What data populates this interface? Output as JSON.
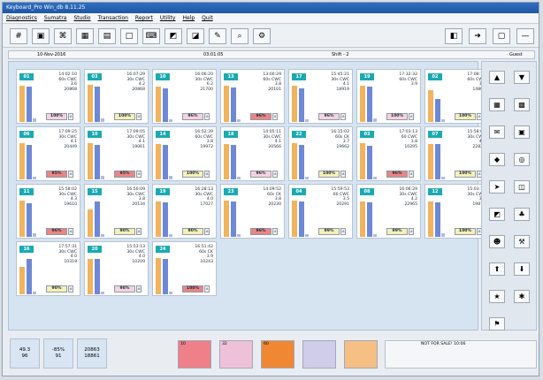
{
  "window_title": "Keyboard_Pro Win_db 8.11.25",
  "menus": [
    "Diagnostics",
    "Sumatra",
    "Studio",
    "Transaction",
    "Report",
    "Utility",
    "Help",
    "Quit"
  ],
  "status": {
    "date": "10-Nov-2016",
    "time": "03:01:05",
    "shift": "Shift - 2",
    "user": "Guest"
  },
  "cards": [
    {
      "id": "01",
      "time": "14:02:10",
      "type": "60s CWC",
      "val": "3.6",
      "count": "20868",
      "pct": "100%",
      "pct_color": "#f6d2e0",
      "bars": [
        0.94,
        0.9,
        0.1
      ]
    },
    {
      "id": "03",
      "time": "16:07:29",
      "type": "30s CWC",
      "val": "4.2",
      "count": "20868",
      "pct": "100%",
      "pct_color": "#f4f0b8",
      "bars": [
        0.95,
        0.9,
        0.08
      ]
    },
    {
      "id": "10",
      "time": "16:06:20",
      "type": "30s CWC",
      "val": "6.2",
      "count": "21700",
      "pct": "96%",
      "pct_color": "#f6d2e0",
      "bars": [
        0.92,
        0.86,
        0.07
      ]
    },
    {
      "id": "13",
      "time": "13:00:29",
      "type": "60s CWC",
      "val": "3.8",
      "count": "20101",
      "pct": "96%",
      "pct_color": "#e98585",
      "bars": [
        0.93,
        0.89,
        0.07
      ]
    },
    {
      "id": "17",
      "time": "15:45:21",
      "type": "30s CWC",
      "val": "4.1",
      "count": "18919",
      "pct": "96%",
      "pct_color": "#f6d2e0",
      "bars": [
        0.93,
        0.87,
        0.06
      ]
    },
    {
      "id": "19",
      "time": "17:32:32",
      "type": "60s CWC",
      "val": "3.9",
      "count": "",
      "pct": "100%",
      "pct_color": "#f6d2e0",
      "bars": [
        0.94,
        0.91,
        0.08
      ]
    },
    {
      "id": "02",
      "time": "17:08:12",
      "type": "60s CWC",
      "val": "3.7",
      "count": "14808",
      "pct": "100%",
      "pct_color": "#f4f0b8",
      "bars": [
        0.82,
        0.6,
        0.07
      ]
    },
    {
      "id": "06",
      "time": "17:09:25",
      "type": "30s CWC",
      "val": "4.1",
      "count": "20449",
      "pct": "95%",
      "pct_color": "#e98585",
      "bars": [
        0.93,
        0.88,
        0.07
      ]
    },
    {
      "id": "10",
      "time": "17:09:05",
      "type": "30s CWC",
      "val": "4.1",
      "count": "19061",
      "pct": "95%",
      "pct_color": "#e98585",
      "bars": [
        0.93,
        0.88,
        0.08
      ]
    },
    {
      "id": "14",
      "time": "16:52:39",
      "type": "60s CWC",
      "val": "3.8",
      "count": "19972",
      "pct": "100%",
      "pct_color": "#f4f0b8",
      "bars": [
        0.92,
        0.88,
        0.08
      ]
    },
    {
      "id": "18",
      "time": "14:05:11",
      "type": "30s CWC",
      "val": "4.1",
      "count": "20566",
      "pct": "96%",
      "pct_color": "#f6d2e0",
      "bars": [
        0.92,
        0.89,
        0.07
      ]
    },
    {
      "id": "22",
      "time": "16:15:02",
      "type": "60s CK",
      "val": "3.7",
      "count": "19662",
      "pct": "100%",
      "pct_color": "#f4f0b8",
      "bars": [
        0.94,
        0.88,
        0.06
      ]
    },
    {
      "id": "03",
      "time": "17:03:13",
      "type": "60 CWC",
      "val": "3.8",
      "count": "10295",
      "pct": "96%",
      "pct_color": "#e98585",
      "bars": [
        0.93,
        0.87,
        0.07
      ]
    },
    {
      "id": "07",
      "time": "15:58:08",
      "type": "30s CWC",
      "val": "4.2",
      "count": "22822",
      "pct": "100%",
      "pct_color": "#f4f0b8",
      "bars": [
        0.92,
        0.9,
        0.07
      ]
    },
    {
      "id": "11",
      "time": "15:58:02",
      "type": "30s CWC",
      "val": "4.3",
      "count": "19610",
      "pct": "96%",
      "pct_color": "#e98585",
      "bars": [
        0.93,
        0.86,
        0.08
      ]
    },
    {
      "id": "15",
      "time": "16:50:09",
      "type": "30s CWC",
      "val": "3.8",
      "count": "20134",
      "pct": "90%",
      "pct_color": "#f4f0b8",
      "bars": [
        0.7,
        0.92,
        0.06
      ]
    },
    {
      "id": "19",
      "time": "16:28:13",
      "type": "30s CWC",
      "val": "4.0",
      "count": "17027",
      "pct": "90%",
      "pct_color": "#f4f0b8",
      "bars": [
        0.92,
        0.89,
        0.07
      ]
    },
    {
      "id": "23",
      "time": "14:09:52",
      "type": "60s CK",
      "val": "3.8",
      "count": "20230",
      "pct": "96%",
      "pct_color": "#e98585",
      "bars": [
        0.93,
        0.9,
        0.06
      ]
    },
    {
      "id": "04",
      "time": "15:59:53",
      "type": "60 CWC",
      "val": "3.5",
      "count": "20291",
      "pct": "99%",
      "pct_color": "#f4f0b8",
      "bars": [
        0.93,
        0.9,
        0.07
      ]
    },
    {
      "id": "08",
      "time": "16:06:29",
      "type": "30s CWC",
      "val": "4.2",
      "count": "22965",
      "pct": "99%",
      "pct_color": "#f4f0b8",
      "bars": [
        0.91,
        0.88,
        0.07
      ]
    },
    {
      "id": "12",
      "time": "15:03:18",
      "type": "30s CWC",
      "val": "3.7",
      "count": "19877",
      "pct": "100%",
      "pct_color": "#f4f0b8",
      "bars": [
        0.92,
        0.88,
        0.08
      ]
    },
    {
      "id": "16",
      "time": "17:57:31",
      "type": "30s CWC",
      "val": "4.0",
      "count": "10319",
      "pct": "90%",
      "pct_color": "#f4f0b8",
      "bars": [
        0.7,
        0.92,
        0.07
      ]
    },
    {
      "id": "20",
      "time": "15:53:13",
      "type": "30s CWC",
      "val": "4.0",
      "count": "10209",
      "pct": "98%",
      "pct_color": "#f6d2e0",
      "bars": [
        0.91,
        0.9,
        0.06
      ]
    },
    {
      "id": "24",
      "time": "16:51:42",
      "type": "60s CK",
      "val": "3.9",
      "count": "10243",
      "pct": "100%",
      "pct_color": "#e98585",
      "bars": [
        0.93,
        0.9,
        0.07
      ]
    }
  ],
  "bottom_stats": [
    {
      "top": "49.3",
      "bottom": "96"
    },
    {
      "top": "-85%",
      "bottom": "91"
    },
    {
      "top": "20863",
      "bottom": "18861"
    }
  ],
  "legend": [
    {
      "label": "10",
      "color": "#ef7f89"
    },
    {
      "label": "32",
      "color": "#efc1d9"
    },
    {
      "label": "60",
      "color": "#f08833"
    },
    {
      "label": "",
      "color": "#cfcde9"
    },
    {
      "label": "",
      "color": "#f6bf84"
    }
  ],
  "message": "NOT FOR SALE! 10:06",
  "icons": {
    "toolbar": [
      "hash-icon",
      "monitor-icon",
      "network-icon",
      "save-icon",
      "print-icon",
      "blank-icon",
      "keyboard-icon",
      "chart-icon",
      "tool-icon",
      "edit-icon",
      "search-icon",
      "gear-icon"
    ],
    "toolbar_right": [
      "open-icon",
      "login-icon",
      "page-icon",
      "minimize-icon"
    ],
    "sidebar": [
      "up-icon",
      "down-icon",
      "calendar-icon",
      "grid-icon",
      "mail-icon",
      "monitor2-icon",
      "colors-icon",
      "globe-icon",
      "arrow-icon",
      "config-icon",
      "chart-icon",
      "tree-icon",
      "people-icon",
      "tools-icon",
      "upload-icon",
      "download-icon",
      "star-icon",
      "settings-icon",
      "flag-icon"
    ]
  }
}
